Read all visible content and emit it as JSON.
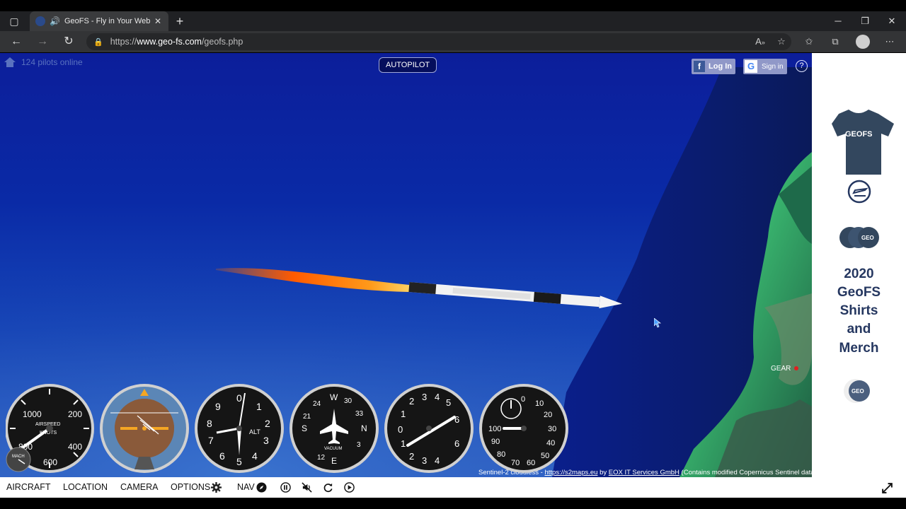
{
  "browser": {
    "tab_title": "GeoFS - Fly in Your Web Bro",
    "url_prefix": "https://",
    "url_host": "www.geo-fs.com",
    "url_path": "/geofs.php"
  },
  "hud": {
    "pilots_online": "124 pilots online",
    "autopilot_label": "AUTOPILOT",
    "facebook_login": "Log In",
    "google_signin": "Sign in",
    "help": "?",
    "gear_label": "GEAR",
    "credit_prefix": "Sentinel-2 cloudless - ",
    "credit_link1": "https://s2maps.eu",
    "credit_by": " by ",
    "credit_link2": "EOX IT Services GmbH",
    "credit_suffix": " (Contains modified Copernicus Sentinel data 2016 & 2017)"
  },
  "gauges": {
    "airspeed": {
      "label1": "AIRSPEED",
      "label2": "KNOTS",
      "ticks": [
        "1000",
        "200",
        "400",
        "600",
        "800"
      ],
      "mach_label": "MACH"
    },
    "altimeter": {
      "label": "ALT",
      "ticks": [
        "0",
        "1",
        "2",
        "3",
        "4",
        "5",
        "6",
        "7",
        "8",
        "9"
      ]
    },
    "heading": {
      "label": "VACUUM",
      "ticks": [
        "W",
        "30",
        "33",
        "N",
        "3",
        "E",
        "12",
        "S",
        "21",
        "24"
      ]
    },
    "vsi": {
      "ticks": [
        "0",
        "1",
        "2",
        "3",
        "4",
        "5",
        "4",
        "3",
        "2",
        "1",
        "6",
        "6"
      ]
    },
    "rpm": {
      "ticks": [
        "0",
        "10",
        "20",
        "30",
        "40",
        "50",
        "60",
        "70",
        "80",
        "90",
        "100"
      ]
    }
  },
  "ad": {
    "line1": "2020",
    "line2": "GeoFS",
    "line3": "Shirts",
    "line4": "and",
    "line5": "Merch",
    "shirt_text": "GEOFS",
    "badge_text": "GEO"
  },
  "menu": {
    "aircraft": "AIRCRAFT",
    "location": "LOCATION",
    "camera": "CAMERA",
    "options": "OPTIONS",
    "nav": "NAV"
  },
  "colors": {
    "sky": "#0c1e9a",
    "ocean": "#2c62c6",
    "ad_text": "#253760",
    "flame": "#ff8a1a"
  }
}
